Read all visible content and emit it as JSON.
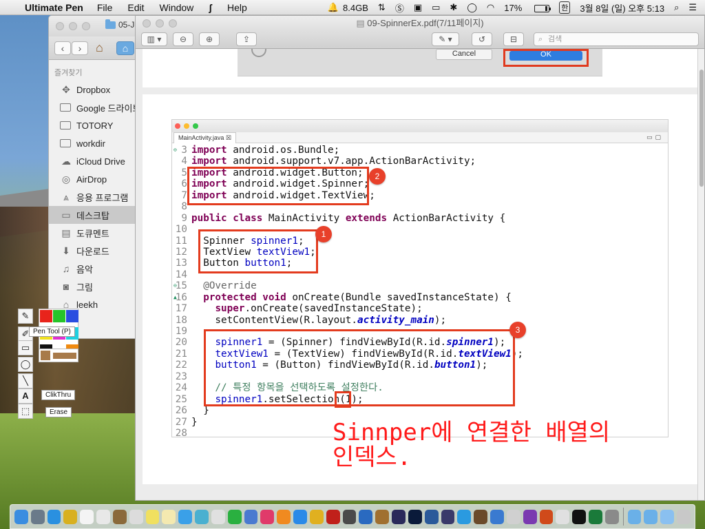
{
  "menubar": {
    "app_name": "Ultimate Pen",
    "menus": [
      "File",
      "Edit",
      "Window",
      "Help"
    ],
    "memory": "8.4GB",
    "battery_percent": "17%",
    "battery_level": 0.17,
    "ime": "한",
    "datetime": "3월 8일 (일) 오후 5:13"
  },
  "finder": {
    "tab_title": "05-J",
    "favorites_header": "즐겨찾기",
    "items": [
      {
        "label": "Dropbox",
        "icon": "dropbox-icon"
      },
      {
        "label": "Google 드라이브",
        "icon": "folder-icon"
      },
      {
        "label": "TOTORY",
        "icon": "folder-icon"
      },
      {
        "label": "workdir",
        "icon": "folder-icon"
      },
      {
        "label": "iCloud Drive",
        "icon": "cloud-icon"
      },
      {
        "label": "AirDrop",
        "icon": "airdrop-icon"
      },
      {
        "label": "응용 프로그램",
        "icon": "applications-icon"
      },
      {
        "label": "데스크탑",
        "icon": "desktop-icon",
        "selected": true
      },
      {
        "label": "도큐멘트",
        "icon": "documents-icon"
      },
      {
        "label": "다운로드",
        "icon": "downloads-icon"
      },
      {
        "label": "음악",
        "icon": "music-icon"
      },
      {
        "label": "그림",
        "icon": "pictures-icon"
      },
      {
        "label": "leekh",
        "icon": "home-icon"
      }
    ]
  },
  "preview": {
    "title": "09-SpinnerEx.pdf(7/11페이지)",
    "search_placeholder": "검색",
    "dialog": {
      "cancel_label": "Cancel",
      "ok_label": "OK"
    }
  },
  "editor": {
    "tab_label": "MainActivity.java ☒",
    "code_lines": [
      {
        "n": "3",
        "marker": "⊖",
        "tokens": [
          {
            "t": "import",
            "c": "kw"
          },
          {
            "t": " android.os.Bundle;",
            "c": "cl"
          }
        ]
      },
      {
        "n": "4",
        "tokens": [
          {
            "t": "import",
            "c": "kw"
          },
          {
            "t": " android.support.v7.app.ActionBarActivity;",
            "c": "cl"
          }
        ]
      },
      {
        "n": "5",
        "tokens": [
          {
            "t": "import",
            "c": "kw"
          },
          {
            "t": " android.widget.Button;",
            "c": "cl"
          }
        ]
      },
      {
        "n": "6",
        "tokens": [
          {
            "t": "import",
            "c": "kw"
          },
          {
            "t": " android.widget.Spinner;",
            "c": "cl"
          }
        ]
      },
      {
        "n": "7",
        "tokens": [
          {
            "t": "import",
            "c": "kw"
          },
          {
            "t": " android.widget.TextView;",
            "c": "cl"
          }
        ]
      },
      {
        "n": "8",
        "tokens": []
      },
      {
        "n": "9",
        "tokens": [
          {
            "t": "public",
            "c": "kw"
          },
          {
            "t": " ",
            "c": "cl"
          },
          {
            "t": "class",
            "c": "kw"
          },
          {
            "t": " MainActivity ",
            "c": "cl"
          },
          {
            "t": "extends",
            "c": "kw"
          },
          {
            "t": " ActionBarActivity {",
            "c": "cl"
          }
        ]
      },
      {
        "n": "10",
        "tokens": []
      },
      {
        "n": "11",
        "tokens": [
          {
            "t": "  Spinner ",
            "c": "cl"
          },
          {
            "t": "spinner1",
            "c": "fd"
          },
          {
            "t": ";",
            "c": "cl"
          }
        ]
      },
      {
        "n": "12",
        "tokens": [
          {
            "t": "  TextView ",
            "c": "cl"
          },
          {
            "t": "textView1",
            "c": "fd"
          },
          {
            "t": ";",
            "c": "cl"
          }
        ]
      },
      {
        "n": "13",
        "tokens": [
          {
            "t": "  Button ",
            "c": "cl"
          },
          {
            "t": "button1",
            "c": "fd"
          },
          {
            "t": ";",
            "c": "cl"
          }
        ]
      },
      {
        "n": "14",
        "tokens": []
      },
      {
        "n": "15",
        "marker": "⊖",
        "tokens": [
          {
            "t": "  @Override",
            "c": "an"
          }
        ]
      },
      {
        "n": "16",
        "marker": "▲",
        "tokens": [
          {
            "t": "  ",
            "c": "cl"
          },
          {
            "t": "protected",
            "c": "kw"
          },
          {
            "t": " ",
            "c": "cl"
          },
          {
            "t": "void",
            "c": "kw"
          },
          {
            "t": " onCreate(Bundle savedInstanceState) {",
            "c": "cl"
          }
        ]
      },
      {
        "n": "17",
        "tokens": [
          {
            "t": "    ",
            "c": "cl"
          },
          {
            "t": "super",
            "c": "kw"
          },
          {
            "t": ".onCreate(savedInstanceState);",
            "c": "cl"
          }
        ]
      },
      {
        "n": "18",
        "tokens": [
          {
            "t": "    setContentView(R.layout.",
            "c": "cl"
          },
          {
            "t": "activity_main",
            "c": "fi"
          },
          {
            "t": ");",
            "c": "cl"
          }
        ]
      },
      {
        "n": "19",
        "tokens": []
      },
      {
        "n": "20",
        "tokens": [
          {
            "t": "    ",
            "c": "cl"
          },
          {
            "t": "spinner1",
            "c": "fd"
          },
          {
            "t": " = (Spinner) findViewById(R.id.",
            "c": "cl"
          },
          {
            "t": "spinner1",
            "c": "fi"
          },
          {
            "t": ");",
            "c": "cl"
          }
        ]
      },
      {
        "n": "21",
        "tokens": [
          {
            "t": "    ",
            "c": "cl"
          },
          {
            "t": "textView1",
            "c": "fd"
          },
          {
            "t": " = (TextView) findViewById(R.id.",
            "c": "cl"
          },
          {
            "t": "textView1",
            "c": "fi"
          },
          {
            "t": ");",
            "c": "cl"
          }
        ]
      },
      {
        "n": "22",
        "tokens": [
          {
            "t": "    ",
            "c": "cl"
          },
          {
            "t": "button1",
            "c": "fd"
          },
          {
            "t": " = (Button) findViewById(R.id.",
            "c": "cl"
          },
          {
            "t": "button1",
            "c": "fi"
          },
          {
            "t": ");",
            "c": "cl"
          }
        ]
      },
      {
        "n": "23",
        "tokens": []
      },
      {
        "n": "24",
        "tokens": [
          {
            "t": "    // 특정 항목을 선택하도록 설정한다.",
            "c": "cm"
          }
        ]
      },
      {
        "n": "25",
        "tokens": [
          {
            "t": "    ",
            "c": "cl"
          },
          {
            "t": "spinner1",
            "c": "fd"
          },
          {
            "t": ".setSelection(1);",
            "c": "cl"
          }
        ]
      },
      {
        "n": "26",
        "tokens": [
          {
            "t": "  }",
            "c": "cl"
          }
        ]
      },
      {
        "n": "27",
        "tokens": [
          {
            "t": "}",
            "c": "cl"
          }
        ]
      },
      {
        "n": "28",
        "tokens": []
      }
    ],
    "badges": [
      "2",
      "1",
      "3"
    ],
    "annotation_line1": "Sinnper에 연결한 배열의",
    "annotation_line2": "인덱스."
  },
  "palette": {
    "tooltip": "Pen Tool (P)",
    "clickthru_label": "ClikThru",
    "erase_label": "Erase",
    "colors": [
      "#e8241b",
      "#27c42a",
      "#2a4ee0",
      "#f0e020",
      "#e030d0",
      "#20d0e0",
      "#111111",
      "#ffffff",
      "#f08a10"
    ]
  },
  "dock": {
    "icons": [
      {
        "name": "finder-icon",
        "color": "#3a8de0"
      },
      {
        "name": "launchpad-icon",
        "color": "#6a7a8a"
      },
      {
        "name": "safari-icon",
        "color": "#2a90e0"
      },
      {
        "name": "chrome-icon",
        "color": "#d8b020"
      },
      {
        "name": "calendar-icon",
        "color": "#f4f4f4"
      },
      {
        "name": "reminders-icon",
        "color": "#e8e8e8"
      },
      {
        "name": "notes-brown-icon",
        "color": "#8a6a3a"
      },
      {
        "name": "clock-icon",
        "color": "#dcdcdc"
      },
      {
        "name": "stickies-icon",
        "color": "#f0e060"
      },
      {
        "name": "notes-icon",
        "color": "#f4e9b0"
      },
      {
        "name": "messages-icon",
        "color": "#3aa0e8"
      },
      {
        "name": "photos-icon",
        "color": "#4ab0d0"
      },
      {
        "name": "preview-icon",
        "color": "#e0e0e0"
      },
      {
        "name": "numbers-icon",
        "color": "#2ab040"
      },
      {
        "name": "keynote-icon",
        "color": "#4a7ad0"
      },
      {
        "name": "itunes-icon",
        "color": "#e03a6a"
      },
      {
        "name": "ibooks-icon",
        "color": "#f08a20"
      },
      {
        "name": "appstore-icon",
        "color": "#2a8ae8"
      },
      {
        "name": "sequel-icon",
        "color": "#e0b020"
      },
      {
        "name": "filezilla-icon",
        "color": "#c0201a"
      },
      {
        "name": "sublime-icon",
        "color": "#4a4a4a"
      },
      {
        "name": "transmit-icon",
        "color": "#2a6ac0"
      },
      {
        "name": "coffee-icon",
        "color": "#a07030"
      },
      {
        "name": "eclipse-icon",
        "color": "#2a2a5a"
      },
      {
        "name": "photoshop-icon",
        "color": "#0a1a3a"
      },
      {
        "name": "s-app-icon",
        "color": "#2a5a9a"
      },
      {
        "name": "eclipse2-icon",
        "color": "#3a3a6a"
      },
      {
        "name": "checkmark-icon",
        "color": "#2a9ae0"
      },
      {
        "name": "box-icon",
        "color": "#6a4a2a"
      },
      {
        "name": "xcode-icon",
        "color": "#3a7ad0"
      },
      {
        "name": "pen-app-icon",
        "color": "#d0d0d0"
      },
      {
        "name": "vm-icon",
        "color": "#7a3ab0"
      },
      {
        "name": "powerpoint-icon",
        "color": "#d04a1a"
      },
      {
        "name": "presenter-icon",
        "color": "#e0e0e0"
      },
      {
        "name": "terminal-icon",
        "color": "#111111"
      },
      {
        "name": "excel-icon",
        "color": "#1a7a3a"
      },
      {
        "name": "sysprefs-icon",
        "color": "#8a8a8a"
      },
      {
        "name": "folder-blue-icon",
        "color": "#6ab0e8"
      },
      {
        "name": "folder-blue2-icon",
        "color": "#6ab0e8"
      },
      {
        "name": "downloads-stack-icon",
        "color": "#8ac0f0"
      },
      {
        "name": "trash-icon",
        "color": "#c8c8c8"
      }
    ]
  }
}
